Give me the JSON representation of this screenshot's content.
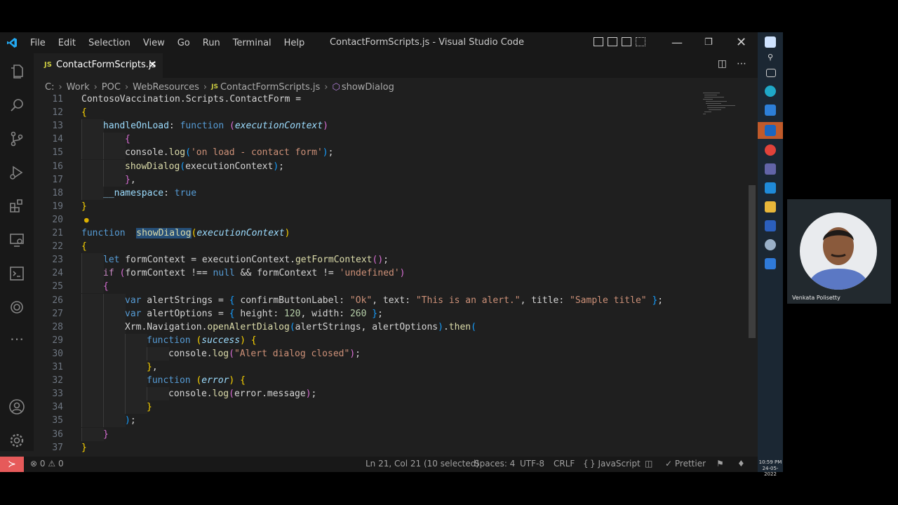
{
  "titlebar": {
    "menu": [
      "File",
      "Edit",
      "Selection",
      "View",
      "Go",
      "Run",
      "Terminal",
      "Help"
    ],
    "title": "ContactFormScripts.js - Visual Studio Code"
  },
  "tab": {
    "icon": "JS",
    "name": "ContactFormScripts.js"
  },
  "breadcrumb": [
    "C:",
    "Work",
    "POC",
    "WebResources",
    "ContactFormScripts.js",
    "showDialog"
  ],
  "editor": {
    "lines": [
      {
        "n": "11",
        "indent": 0,
        "tokens": [
          [
            "ContosoVaccination.Scripts.ContactForm",
            "plain"
          ],
          [
            " = ",
            "plain"
          ]
        ]
      },
      {
        "n": "12",
        "indent": 0,
        "tokens": [
          [
            "{",
            "br1"
          ]
        ]
      },
      {
        "n": "13",
        "indent": 1,
        "tokens": [
          [
            "handleOnLoad",
            "prop"
          ],
          [
            ": ",
            "plain"
          ],
          [
            "function",
            "kw"
          ],
          [
            " ",
            "plain"
          ],
          [
            "(",
            "br2"
          ],
          [
            "executionContext",
            "prm"
          ],
          [
            ")",
            "br2"
          ]
        ]
      },
      {
        "n": "14",
        "indent": 2,
        "tokens": [
          [
            "{",
            "br2"
          ]
        ]
      },
      {
        "n": "15",
        "indent": 2,
        "tokens": [
          [
            "console",
            "plain"
          ],
          [
            ".",
            "plain"
          ],
          [
            "log",
            "fn"
          ],
          [
            "(",
            "br3"
          ],
          [
            "'on load - contact form'",
            "str"
          ],
          [
            ")",
            "br3"
          ],
          [
            ";",
            "plain"
          ]
        ]
      },
      {
        "n": "16",
        "indent": 2,
        "tokens": [
          [
            "showDialog",
            "fn"
          ],
          [
            "(",
            "br3"
          ],
          [
            "executionContext",
            "plain"
          ],
          [
            ")",
            "br3"
          ],
          [
            ";",
            "plain"
          ]
        ]
      },
      {
        "n": "17",
        "indent": 2,
        "tokens": [
          [
            "}",
            "br2"
          ],
          [
            ",",
            "plain"
          ]
        ]
      },
      {
        "n": "18",
        "indent": 1,
        "tokens": [
          [
            "__namespace",
            "prop"
          ],
          [
            ": ",
            "plain"
          ],
          [
            "true",
            "kw"
          ]
        ]
      },
      {
        "n": "19",
        "indent": 0,
        "tokens": [
          [
            "}",
            "br1"
          ]
        ]
      },
      {
        "n": "20",
        "indent": 0,
        "tokens": []
      },
      {
        "n": "21",
        "indent": 0,
        "tokens": [
          [
            "function",
            "kw"
          ],
          [
            "  ",
            "plain"
          ],
          [
            "showDialog",
            "sel"
          ],
          [
            "(",
            "br1"
          ],
          [
            "executionContext",
            "prm"
          ],
          [
            ")",
            "br1"
          ]
        ]
      },
      {
        "n": "22",
        "indent": 0,
        "tokens": [
          [
            "{",
            "br1"
          ]
        ]
      },
      {
        "n": "23",
        "indent": 1,
        "tokens": [
          [
            "let",
            "kw"
          ],
          [
            " formContext = executionContext.",
            "plain"
          ],
          [
            "getFormContext",
            "fn"
          ],
          [
            "()",
            "br2"
          ],
          [
            ";",
            "plain"
          ]
        ]
      },
      {
        "n": "24",
        "indent": 1,
        "tokens": [
          [
            "if",
            "ctl"
          ],
          [
            " ",
            "plain"
          ],
          [
            "(",
            "br2"
          ],
          [
            "formContext !== ",
            "plain"
          ],
          [
            "null",
            "kw"
          ],
          [
            " && formContext != ",
            "plain"
          ],
          [
            "'undefined'",
            "str"
          ],
          [
            ")",
            "br2"
          ]
        ]
      },
      {
        "n": "25",
        "indent": 1,
        "tokens": [
          [
            "{",
            "br2"
          ]
        ]
      },
      {
        "n": "26",
        "indent": 2,
        "tokens": [
          [
            "var",
            "kw"
          ],
          [
            " alertStrings = ",
            "plain"
          ],
          [
            "{",
            "br3"
          ],
          [
            " confirmButtonLabel: ",
            "plain"
          ],
          [
            "\"Ok\"",
            "str"
          ],
          [
            ", text: ",
            "plain"
          ],
          [
            "\"This is an alert.\"",
            "str"
          ],
          [
            ", title: ",
            "plain"
          ],
          [
            "\"Sample title\"",
            "str"
          ],
          [
            " ",
            "plain"
          ],
          [
            "}",
            "br3"
          ],
          [
            ";",
            "plain"
          ]
        ]
      },
      {
        "n": "27",
        "indent": 2,
        "tokens": [
          [
            "var",
            "kw"
          ],
          [
            " alertOptions = ",
            "plain"
          ],
          [
            "{",
            "br3"
          ],
          [
            " height: ",
            "plain"
          ],
          [
            "120",
            "num"
          ],
          [
            ", width: ",
            "plain"
          ],
          [
            "260",
            "num"
          ],
          [
            " ",
            "plain"
          ],
          [
            "}",
            "br3"
          ],
          [
            ";",
            "plain"
          ]
        ]
      },
      {
        "n": "28",
        "indent": 2,
        "tokens": [
          [
            "Xrm.Navigation.",
            "plain"
          ],
          [
            "openAlertDialog",
            "fn"
          ],
          [
            "(",
            "br3"
          ],
          [
            "alertStrings, alertOptions",
            "plain"
          ],
          [
            ")",
            "br3"
          ],
          [
            ".",
            "plain"
          ],
          [
            "then",
            "fn"
          ],
          [
            "(",
            "br3"
          ]
        ]
      },
      {
        "n": "29",
        "indent": 3,
        "tokens": [
          [
            "function",
            "kw"
          ],
          [
            " ",
            "plain"
          ],
          [
            "(",
            "br1"
          ],
          [
            "success",
            "prm"
          ],
          [
            ")",
            "br1"
          ],
          [
            " ",
            "plain"
          ],
          [
            "{",
            "br1"
          ]
        ]
      },
      {
        "n": "30",
        "indent": 4,
        "tokens": [
          [
            "console",
            "plain"
          ],
          [
            ".",
            "plain"
          ],
          [
            "log",
            "fn"
          ],
          [
            "(",
            "br2"
          ],
          [
            "\"Alert dialog closed\"",
            "str"
          ],
          [
            ")",
            "br2"
          ],
          [
            ";",
            "plain"
          ]
        ]
      },
      {
        "n": "31",
        "indent": 3,
        "tokens": [
          [
            "}",
            "br1"
          ],
          [
            ",",
            "plain"
          ]
        ]
      },
      {
        "n": "32",
        "indent": 3,
        "tokens": [
          [
            "function",
            "kw"
          ],
          [
            " ",
            "plain"
          ],
          [
            "(",
            "br1"
          ],
          [
            "error",
            "prm"
          ],
          [
            ")",
            "br1"
          ],
          [
            " ",
            "plain"
          ],
          [
            "{",
            "br1"
          ]
        ]
      },
      {
        "n": "33",
        "indent": 4,
        "tokens": [
          [
            "console",
            "plain"
          ],
          [
            ".",
            "plain"
          ],
          [
            "log",
            "fn"
          ],
          [
            "(",
            "br2"
          ],
          [
            "error.message",
            "plain"
          ],
          [
            ")",
            "br2"
          ],
          [
            ";",
            "plain"
          ]
        ]
      },
      {
        "n": "34",
        "indent": 3,
        "tokens": [
          [
            "}",
            "br1"
          ]
        ]
      },
      {
        "n": "35",
        "indent": 2,
        "tokens": [
          [
            ")",
            "br3"
          ],
          [
            ";",
            "plain"
          ]
        ]
      },
      {
        "n": "36",
        "indent": 1,
        "tokens": [
          [
            "}",
            "br2"
          ]
        ]
      },
      {
        "n": "37",
        "indent": 0,
        "tokens": [
          [
            "}",
            "br1"
          ]
        ]
      }
    ]
  },
  "status": {
    "errors": "0",
    "warnings": "0",
    "position": "Ln 21, Col 21 (10 selected)",
    "spaces": "Spaces: 4",
    "encoding": "UTF-8",
    "eol": "CRLF",
    "language": "JavaScript",
    "prettier": "Prettier"
  },
  "taskbar": {
    "time": "10:59 PM",
    "date": "24-05-2022"
  },
  "video": {
    "participant": "Venkata Polisetty"
  },
  "colors": {
    "accent": "#007acc",
    "remote": "#e65a5a",
    "selection": "#264f78"
  }
}
